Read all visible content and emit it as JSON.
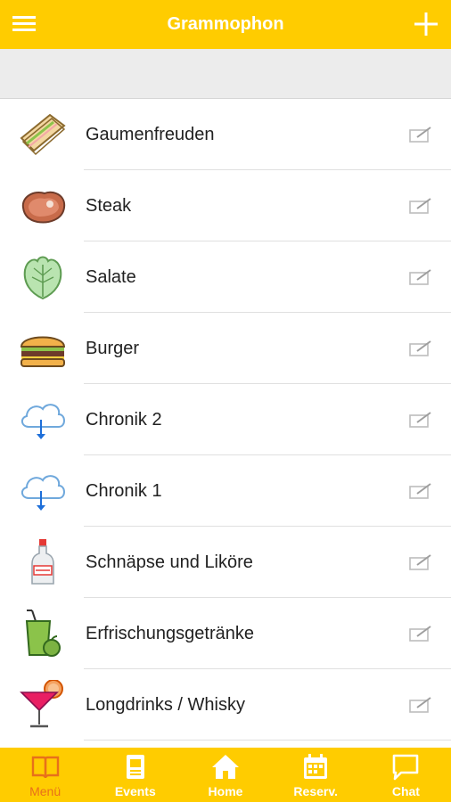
{
  "header": {
    "title": "Grammophon",
    "menu_icon": "hamburger-menu-icon",
    "add_icon": "plus-icon",
    "background_color": "#FFCC00"
  },
  "list": {
    "items": [
      {
        "label": "Gaumenfreuden",
        "icon": "sandwich-icon"
      },
      {
        "label": "Steak",
        "icon": "steak-icon"
      },
      {
        "label": "Salate",
        "icon": "lettuce-icon"
      },
      {
        "label": "Burger",
        "icon": "burger-icon"
      },
      {
        "label": "Chronik 2",
        "icon": "cloud-download-icon"
      },
      {
        "label": "Chronik 1",
        "icon": "cloud-download-icon"
      },
      {
        "label": "Schnäpse und Liköre",
        "icon": "liquor-bottle-icon"
      },
      {
        "label": "Erfrischungsgetränke",
        "icon": "juice-glass-icon"
      },
      {
        "label": "Longdrinks / Whisky",
        "icon": "cocktail-icon"
      }
    ],
    "edit_icon": "edit-icon"
  },
  "bottom_nav": {
    "tabs": [
      {
        "label": "Menü",
        "icon": "book-icon",
        "active": true
      },
      {
        "label": "Events",
        "icon": "document-icon",
        "active": false
      },
      {
        "label": "Home",
        "icon": "home-icon",
        "active": false
      },
      {
        "label": "Reserv.",
        "icon": "calendar-icon",
        "active": false
      },
      {
        "label": "Chat",
        "icon": "chat-bubble-icon",
        "active": false
      }
    ],
    "active_color": "#E8701A"
  }
}
